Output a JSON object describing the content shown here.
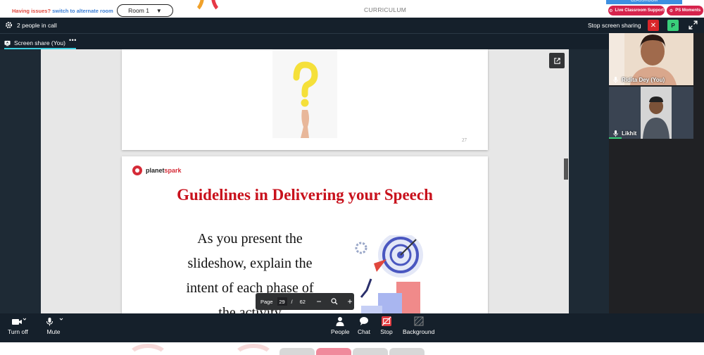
{
  "topbar": {
    "issues_text": "Having issues?",
    "issues_link": "switch to alternate room",
    "room_selected": "Room 1",
    "title": "CURRICULUM",
    "classroom_label": "CLASSROOM",
    "support_label": "Live Classroom Support",
    "moments_label": "PS Moments"
  },
  "call": {
    "people_count": "2 people in call",
    "stop_share_label": "Stop screen sharing",
    "p_badge": "P",
    "share_tab": "Screen share (You)",
    "share_more": "•••"
  },
  "slides": {
    "slide1_page_number": "27",
    "logo_text_a": "planet",
    "logo_text_b": "spark",
    "slide2_title": "Guidelines in Delivering your Speech",
    "slide2_lines": [
      "As you present the",
      "slideshow, explain the",
      "intent of each phase of",
      "the activity"
    ]
  },
  "pager": {
    "label": "Page",
    "current": "29",
    "separator": "/",
    "total": "62",
    "zoom_out": "−",
    "zoom_in": "+"
  },
  "participants": [
    {
      "name": "Ridita Dey (You)"
    },
    {
      "name": "Likhit"
    }
  ],
  "controls": {
    "camera": "Turn off",
    "mute": "Mute",
    "people": "People",
    "chat": "Chat",
    "stop": "Stop",
    "background": "Background"
  },
  "colors": {
    "accent_red": "#d6234c",
    "share_underline": "#3ccfe0",
    "stop_red": "#d9262a",
    "p_green": "#39d07a",
    "slide_title_red": "#c8111c"
  },
  "icons": [
    "gear-icon",
    "close-icon",
    "expand-icon",
    "share-screen-icon",
    "popout-icon",
    "zoom-icon",
    "mic-icon",
    "camera-icon",
    "people-icon",
    "chat-icon",
    "stop-share-icon",
    "background-icon"
  ]
}
